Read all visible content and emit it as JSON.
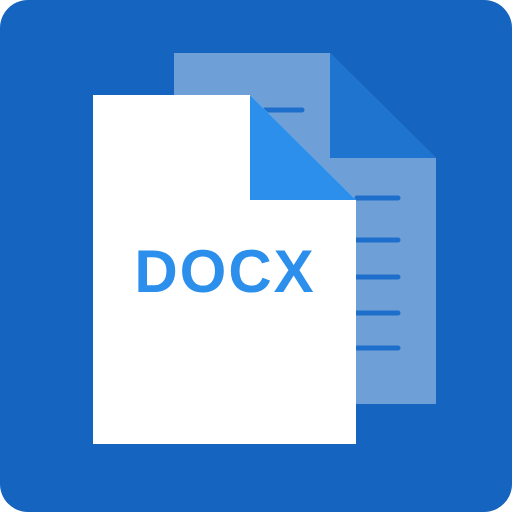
{
  "app_icon": {
    "label": "DOCX",
    "icon_name": "docx-file-icon",
    "colors": {
      "background": "#1565C0",
      "back_page": "#6E9FD6",
      "back_fold": "#1E74CF",
      "back_lines": "#1E6FCB",
      "front_page": "#FFFFFF",
      "front_fold": "#2B8FEB",
      "label": "#2B8FEB"
    }
  }
}
